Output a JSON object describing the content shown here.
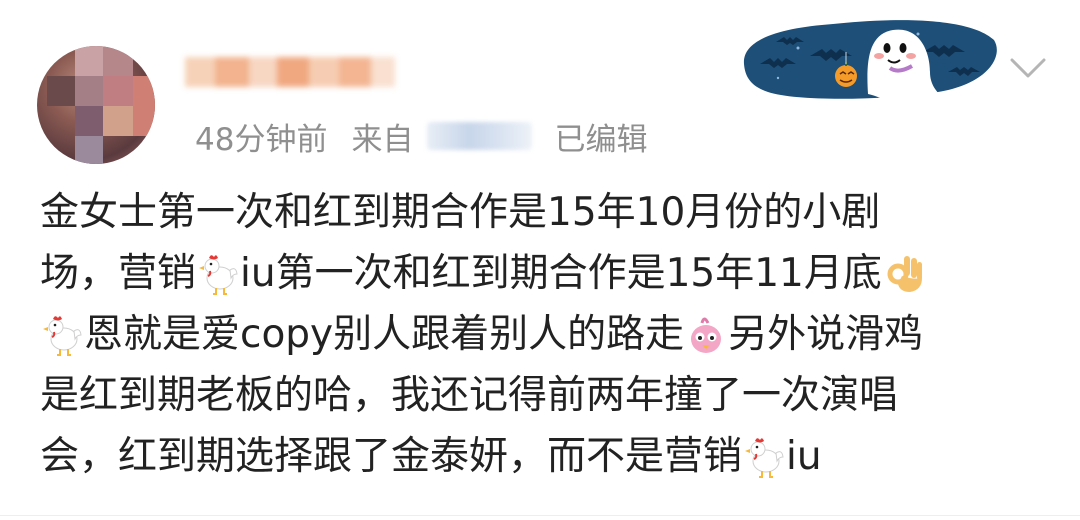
{
  "post": {
    "time": "48分钟前",
    "source_prefix": "来自",
    "edited": "已编辑",
    "lines": [
      [
        "金女士第一次和红到期合作是15年10月份的小剧"
      ],
      [
        "场，营销",
        "iu第一次和红到期合作是15年11月底"
      ],
      [
        "恩就是爱copy别人跟着别人的路走",
        "另外说滑鸡"
      ],
      [
        "是红到期老板的哈，我还记得前两年撞了一次演唱"
      ],
      [
        "会，红到期选择跟了金泰妍，而不是营销",
        "iu"
      ]
    ]
  },
  "icons": {
    "badge": "halloween-ghost-badge-icon",
    "menu": "chevron-down-icon",
    "chicken": "rooster-emoji-icon",
    "ok": "ok-hand-emoji-icon",
    "bird": "pink-bird-emoji-icon"
  }
}
